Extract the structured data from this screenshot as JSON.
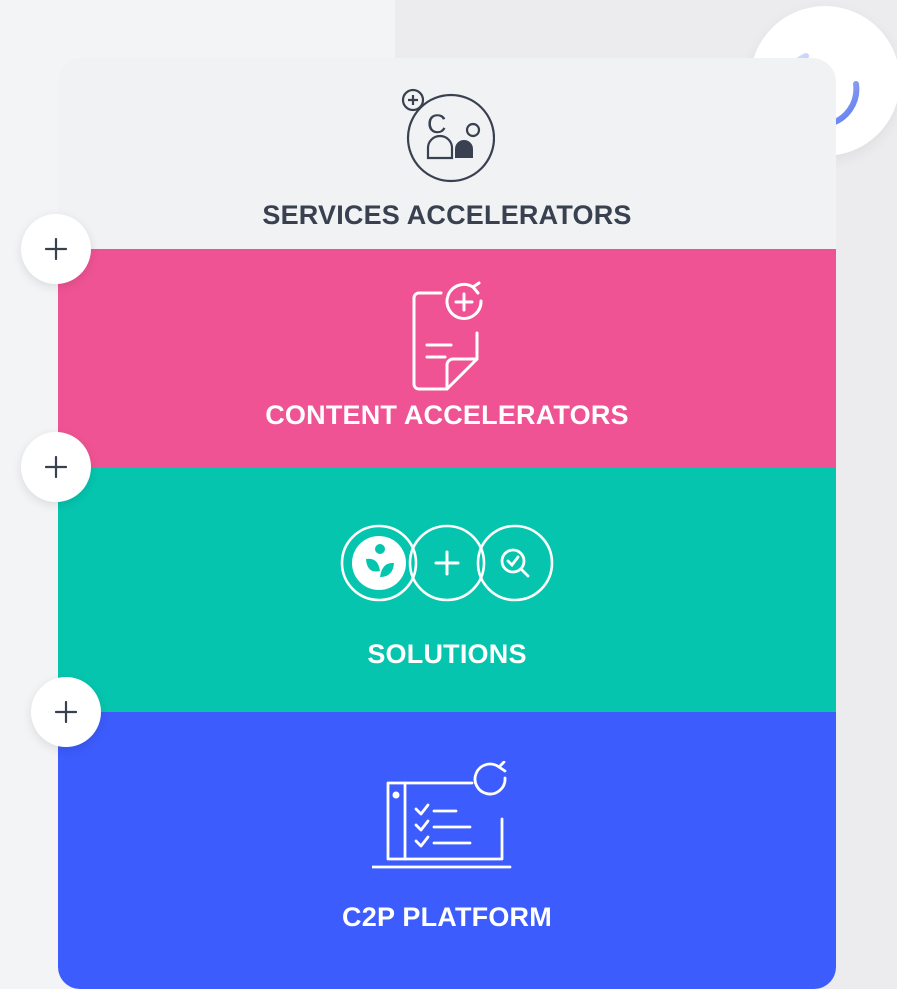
{
  "layers": {
    "services": {
      "label": "SERVICES ACCELERATORS",
      "icon": "people-plus-icon",
      "color": "#f1f2f3"
    },
    "content": {
      "label": "CONTENT ACCELERATORS",
      "icon": "document-refresh-icon",
      "color": "#ef5393"
    },
    "solutions": {
      "label": "SOLUTIONS",
      "icon": "eco-plus-search-icon",
      "color": "#06c5ae"
    },
    "platform": {
      "label": "C2P PLATFORM",
      "icon": "checklist-refresh-icon",
      "color": "#3c5cfd"
    }
  },
  "connectors": [
    "plus-icon",
    "plus-icon",
    "plus-icon"
  ],
  "loader": {
    "icon": "loading-spinner-icon"
  }
}
